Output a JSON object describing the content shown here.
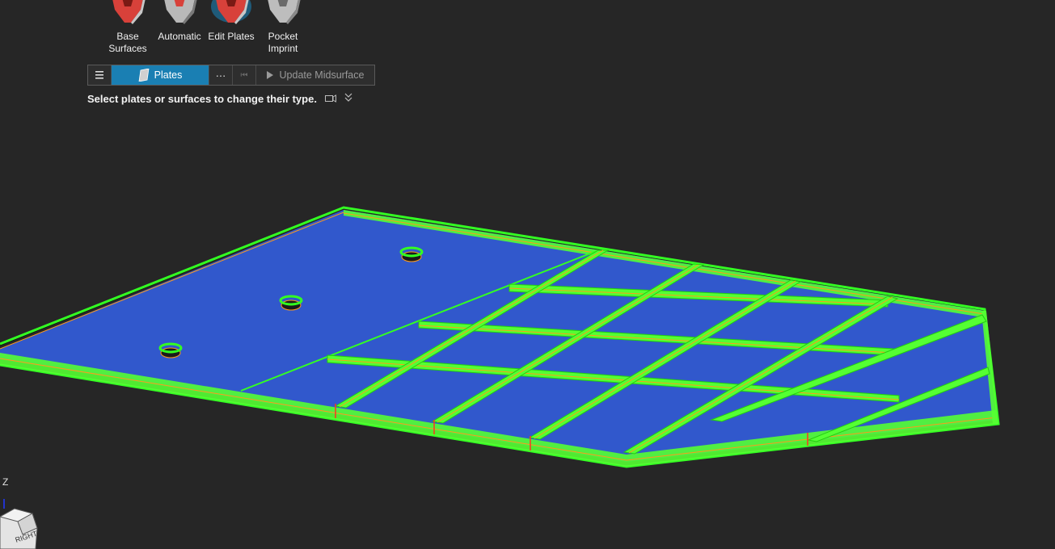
{
  "tools": [
    {
      "label": "Base\nSurfaces",
      "color": "#d8413a"
    },
    {
      "label": "Automatic",
      "color": "#d8413a"
    },
    {
      "label": "Edit Plates",
      "color": "#d8413a",
      "active": true
    },
    {
      "label": "Pocket\nImprint",
      "color": "#9a9a9a"
    }
  ],
  "toolbar": {
    "menu_icon": "hamburger-icon",
    "plates_label": "Plates",
    "more_label": "⋯",
    "first_icon": "⏮",
    "update_label": "Update Midsurface"
  },
  "prompt": {
    "text": "Select plates or surfaces to change their type.",
    "camera_icon": "camera-icon",
    "expand_icon": "double-chevron-down-icon"
  },
  "axis": {
    "z_label": "Z",
    "cube_face": "RIGHT"
  },
  "colors": {
    "background": "#262626",
    "plate_fill": "#3158cc",
    "edge_green": "#33ff22",
    "edge_orange": "#ff9a1a",
    "active_tab": "#1a7fb3"
  }
}
